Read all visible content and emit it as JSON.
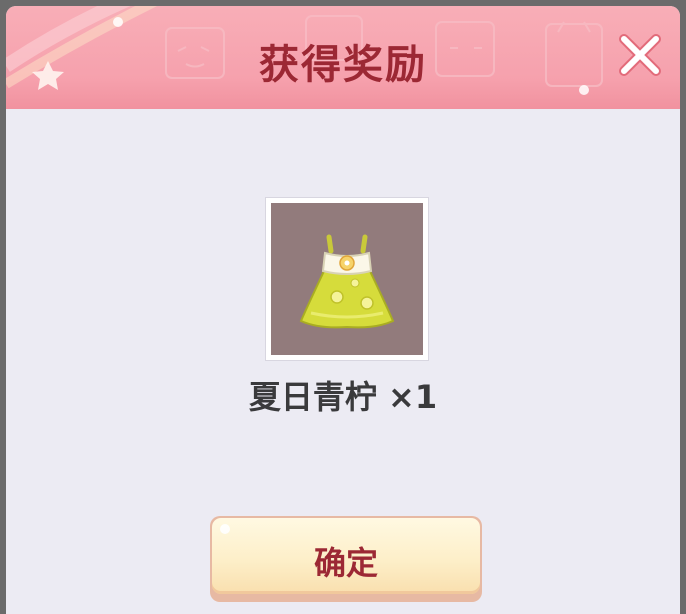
{
  "dialog": {
    "title": "获得奖励",
    "close_icon": "close-x-icon"
  },
  "reward": {
    "item_icon": "summer-dress-icon",
    "item_name": "夏日青柠",
    "quantity_text": "×1",
    "frame_color": "#927b7c"
  },
  "actions": {
    "confirm_label": "确定"
  },
  "colors": {
    "header": "#f6a1ad",
    "title_text": "#9c2834",
    "body_bg": "#ecebf3",
    "button_face": "#fdefc9"
  }
}
